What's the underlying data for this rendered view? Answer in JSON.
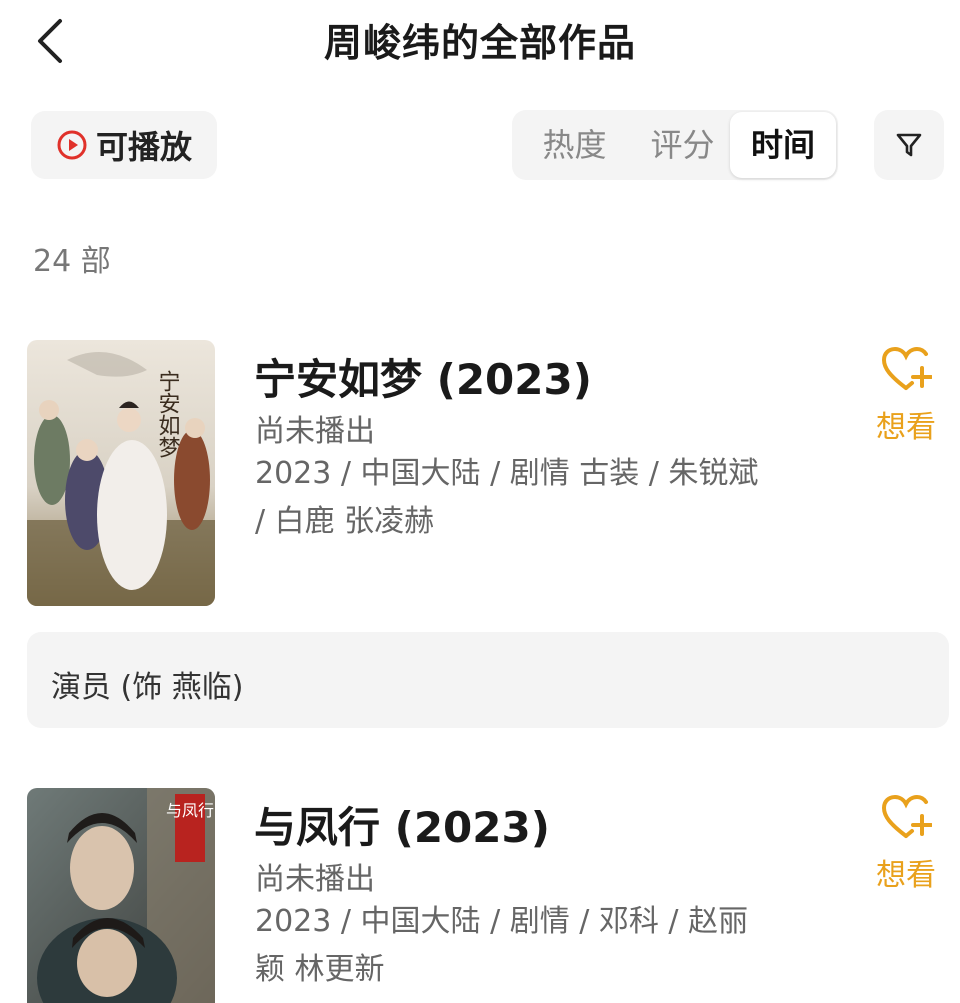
{
  "header": {
    "title": "周峻纬的全部作品"
  },
  "filters": {
    "playable_label": "可播放",
    "sort_tabs": [
      "热度",
      "评分",
      "时间"
    ],
    "active_sort": "时间"
  },
  "count_label": "24 部",
  "films": [
    {
      "title": "宁安如梦 (2023)",
      "status": "尚未播出",
      "meta": "2023 / 中国大陆 / 剧情 古装 / 朱锐斌 / 白鹿 张凌赫",
      "want_label": "想看",
      "role": "演员 (饰 燕临)",
      "poster_text": "宁安如梦"
    },
    {
      "title": "与凤行 (2023)",
      "status": "尚未播出",
      "meta": "2023 / 中国大陆 / 剧情 / 邓科 / 赵丽颖 林更新",
      "want_label": "想看",
      "poster_text": "与凤行"
    }
  ],
  "colors": {
    "accent_red": "#e0312a",
    "want_orange": "#e9a11c"
  }
}
